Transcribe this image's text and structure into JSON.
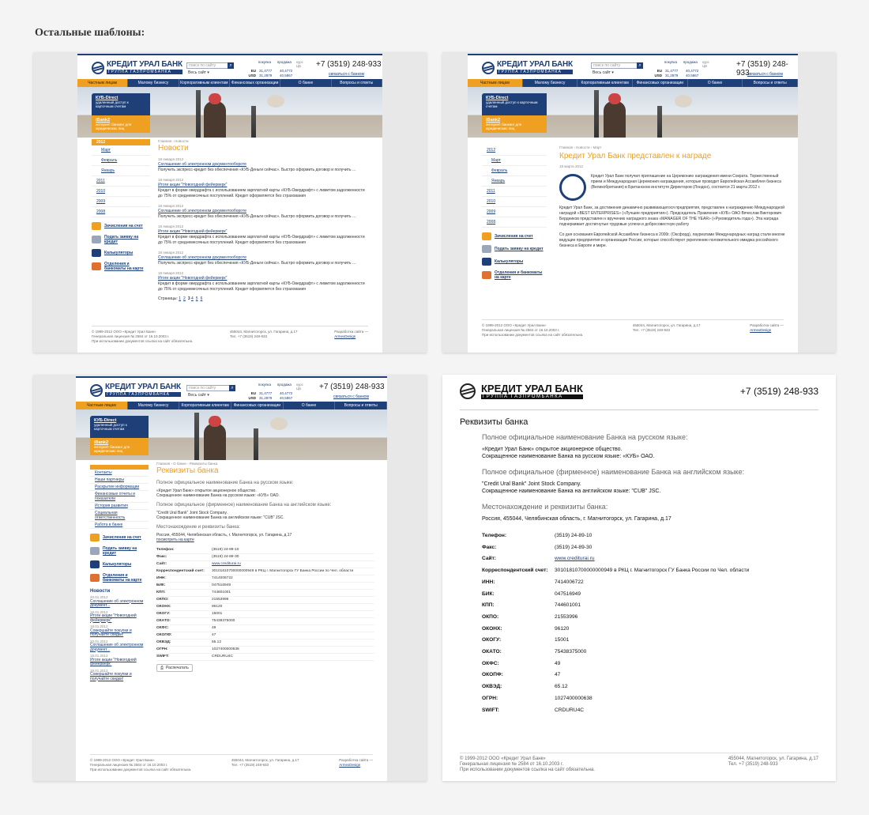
{
  "heading": "Остальные шаблоны:",
  "brand": {
    "name": "КРЕДИТ УРАЛ БАНК",
    "tagline": "ГРУППА ГАЗПРОМБАНКА",
    "navy": "#1e3f77",
    "orange": "#f0a020"
  },
  "header": {
    "search_placeholder": "поиск по сайту",
    "search_scope": "Весь сайт",
    "rates_head": [
      "покупка",
      "продажа",
      "курс ЦБ"
    ],
    "rates": [
      {
        "cur": "EU",
        "buy": "31,4777",
        "sell": "40,4772"
      },
      {
        "cur": "USD",
        "buy": "31,2879",
        "sell": "40,5867"
      }
    ],
    "phone": "+7 (3519) 248-933",
    "contact": "связаться с банком"
  },
  "nav": [
    "Частным лицам",
    "Малому бизнесу",
    "Корпоративным клиентам",
    "Финансовых организации",
    "О банке",
    "Вопросы и ответы"
  ],
  "promo": {
    "kub_title": "КУБ-Direct",
    "kub_text": "удаленный доступ к карточным счетам",
    "ibank_title": "iBank2",
    "ibank_text": "интернет банкинг для юридических лиц"
  },
  "services": [
    "Зачисления на счет",
    "Подать заявку на кредит",
    "Калькуляторы",
    "Отделения и банкоматы на карте"
  ],
  "news_page": {
    "crumbs": "Главная › Новости",
    "title": "Новости",
    "years_tab": "2012",
    "months": [
      "Март",
      "Февраль",
      "Январь"
    ],
    "years": [
      "2011",
      "2010",
      "2009",
      "2008"
    ],
    "items": [
      {
        "date": "18 января 2012",
        "title": "Соглашение об электронном документообороте",
        "text": "Получить экспресс-кредит без обеспечения «КУБ-Деньги сейчас». Быстро оформить договор и получить ..."
      },
      {
        "date": "18 января 2012",
        "title": "Итоги акции \"Новогодний фейерверк\"",
        "text": "Кредит в форме овердрафта с использованием зарплатной карты «КУБ-Овердрафт» с лимитом задолженности до 75% от среднемесячных поступлений. Кредит оформляется без страхования"
      },
      {
        "date": "18 января 2012",
        "title": "Соглашение об электронном документообороте",
        "text": "Получить экспресс-кредит без обеспечения «КУБ-Деньги сейчас». Быстро оформить договор и получить ..."
      },
      {
        "date": "18 января 2012",
        "title": "Итоги акции \"Новогодний фейерверк\"",
        "text": "Кредит в форме овердрафта с использованием зарплатной карты «КУБ-Овердрафт» с лимитом задолженности до 75% от среднемесячных поступлений. Кредит оформляется без страхования"
      },
      {
        "date": "18 января 2012",
        "title": "Соглашение об электронном документообороте",
        "text": "Получить экспресс-кредит без обеспечения «КУБ-Деньги сейчас». Быстро оформить договор и получить ..."
      },
      {
        "date": "18 января 2012",
        "title": "Итоги акции \"Новогодний фейерверк\"",
        "text": "Кредит в форме овердрафта с использованием зарплатной карты «КУБ-Овердрафт» с лимитом задолженности до 75% от среднемесячных поступлений. Кредит оформляется без страхования"
      }
    ],
    "pager_label": "Страницы:",
    "pages": [
      "1",
      "2",
      "3",
      "4",
      "5",
      "6"
    ]
  },
  "article_page": {
    "crumbs": "Главная › Новости › Март",
    "title": "Кредит Урал Банк представлен к награде",
    "date": "18 марта 2012",
    "p1": "Кредит Урал Банк получил приглашение на Церемонию награждения имени Сократа. Торжественный прием и Международная Церемония награждения, которые проводит Европейская Ассамблея бизнеса (Великобритания) в Британском институте Директоров (Лондон), состоится 21 марта 2012 г.",
    "p2": "Кредит Урал Банк, за достижения динамично развивающегося предприятия, представлен к награждению Международной наградой «BEST ENTERPRISES» («Лучшие предприятия»). Председатель Правления «КУБ» ОАО Вячеслав Викторович Бердников представлен к вручению наградного знака «MANAGER OF THE YEAR» («Руководитель года»). Эта награда подчеркивает достигнутые трудовые успехи и добросовестную работу",
    "p3": "Со дня основания Европейской Ассамблеи бизнеса в 2000г. (Оксфорд), лауреатами Международных наград стали многие ведущие предприятия и организации России, которые способствуют укреплению положительного имиджа российского бизнеса в Европе и мире."
  },
  "requisites": {
    "crumbs": "Главная › О банке › Реквизиты банка",
    "title": "Реквизиты банка",
    "menu": [
      "Контакты",
      "Наши партнеры",
      "Раскрытие информации",
      "Финансовые отчеты и показатели",
      "История развития",
      "Социальная ответственность",
      "Работа в банке"
    ],
    "sub1": "Полное официальное наименование Банка на русском языке:",
    "ru_full": "«Кредит Урал Банк» открытое акционерное общество.",
    "ru_short": "Сокращенное наименование Банка на русском языке: «КУБ» ОАО.",
    "sub2": "Полное официальное (фирменное) наименование Банка на английском языке:",
    "en_full": "\"Credit Ural Bank\" Joint Stock Company.",
    "en_short": "Сокращенное наименование Банка на английском языке: \"CUB\" JSC.",
    "sub3": "Местонахождение и реквизиты банка:",
    "address": "Россия, 455044, Челябинская область, г. Магнитогорск, ул. Гагарина, д.17",
    "map_link": "посмотреть на карте",
    "rows": [
      [
        "Телефон:",
        "(3519) 24-89-10"
      ],
      [
        "Факс:",
        "(3519) 24-89-30"
      ],
      [
        "Сайт:",
        "www.crediturai.ru"
      ],
      [
        "Корреспондентский счет:",
        "30101810700000000949 в РКЦ г. Магнитогорск ГУ Банка России по Чел. области"
      ],
      [
        "ИНН:",
        "7414006722"
      ],
      [
        "БИК:",
        "047516949"
      ],
      [
        "КПП:",
        "744601001"
      ],
      [
        "ОКПО:",
        "21553996"
      ],
      [
        "ОКОНХ:",
        "96120"
      ],
      [
        "ОКОГУ:",
        "15001"
      ],
      [
        "ОКАТО:",
        "75438375000"
      ],
      [
        "ОКФС:",
        "49"
      ],
      [
        "ОКОПФ:",
        "47"
      ],
      [
        "ОКВЭД:",
        "65.12"
      ],
      [
        "ОГРН:",
        "1027400000638"
      ],
      [
        "SWIFT:",
        "CRDURU4C"
      ]
    ],
    "print_label": "Распечатать",
    "news_title": "Новости",
    "news": [
      {
        "date": "20.01.2012",
        "title": "Соглашение об электронном документ..."
      },
      {
        "date": "18.01.2012",
        "title": "Итоги акции \"Новогодний фейерверк\""
      },
      {
        "date": "18.01.2012",
        "title": "Совершайте покупки и получайте скидки!"
      },
      {
        "date": "20.01.2012",
        "title": "Соглашение об электронном документ..."
      },
      {
        "date": "18.01.2012",
        "title": "Итоги акции \"Новогодний фейерверк\""
      },
      {
        "date": "18.01.2012",
        "title": "Совершайте покупки и получайте скидки!"
      }
    ]
  },
  "footer": {
    "copy": "© 1999-2012 ООО «Кредит Урал Банк»",
    "license": "Генеральная лицензия № 2584 от 16.10.2003 г.",
    "note": "При использовании документов ссылка на сайт обязательна.",
    "address": "455044, Магнитогорск, ул. Гагарина, д.17",
    "tel": "Тел. +7 (3519) 248-933",
    "dev": "Разработка сайта —",
    "dev_link": "ArmexDesign"
  }
}
